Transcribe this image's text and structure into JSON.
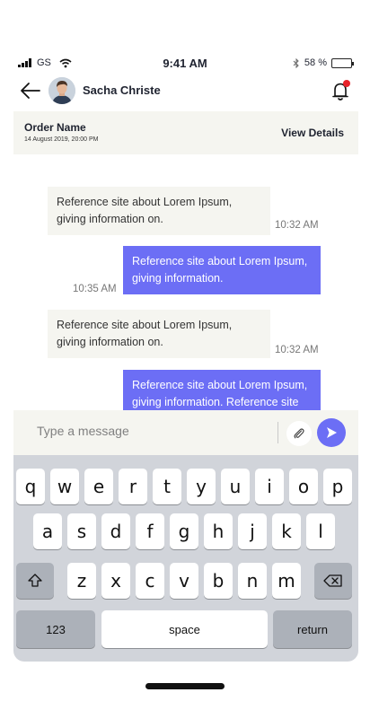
{
  "status_bar": {
    "carrier": "GS",
    "time": "9:41 AM",
    "battery_text": "58 %",
    "battery_level": 0.58,
    "icons": [
      "signal-icon",
      "wifi-icon",
      "bluetooth-icon",
      "battery-icon"
    ]
  },
  "header": {
    "contact_name": "Sacha Christe",
    "icons": [
      "back-arrow-icon",
      "avatar",
      "bell-icon"
    ],
    "notification_dot_color": "#e8232a"
  },
  "order": {
    "title": "Order Name",
    "date": "14 August 2019, 20:00 PM",
    "action_label": "View Details"
  },
  "messages": [
    {
      "direction": "in",
      "text": "Reference site about Lorem Ipsum, giving information on.",
      "time": "10:32 AM"
    },
    {
      "direction": "out",
      "text": "Reference site about Lorem Ipsum, giving information.",
      "time": "10:35 AM"
    },
    {
      "direction": "in",
      "text": "Reference site about Lorem Ipsum, giving information on.",
      "time": "10:32 AM"
    },
    {
      "direction": "out",
      "text": "Reference site about Lorem Ipsum, giving information. Reference site",
      "time": ""
    }
  ],
  "composer": {
    "placeholder": "Type a message",
    "icons": [
      "paperclip-icon",
      "send-icon"
    ]
  },
  "keyboard": {
    "row1": [
      "q",
      "w",
      "e",
      "r",
      "t",
      "y",
      "u",
      "i",
      "o",
      "p"
    ],
    "row2": [
      "a",
      "s",
      "d",
      "f",
      "g",
      "h",
      "j",
      "k",
      "l"
    ],
    "row3": [
      "z",
      "x",
      "c",
      "v",
      "b",
      "n",
      "m"
    ],
    "numbers_label": "123",
    "space_label": "space",
    "return_label": "return",
    "icons": [
      "shift-icon",
      "backspace-icon"
    ]
  },
  "colors": {
    "accent": "#6c6ef5",
    "panel": "#f5f5f0",
    "keyboard_bg": "#d1d4da",
    "key_dark": "#acb1b9"
  }
}
